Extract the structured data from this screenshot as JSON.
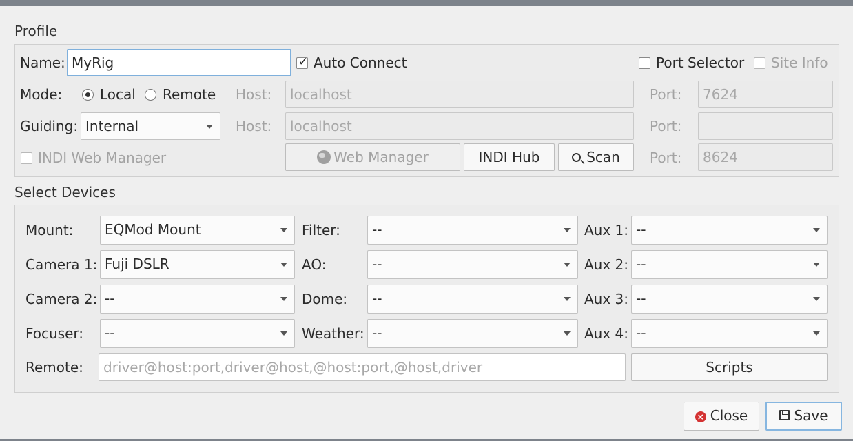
{
  "profile": {
    "section_title": "Profile",
    "name_label": "Name:",
    "name_value": "MyRig",
    "auto_connect_label": "Auto Connect",
    "auto_connect_checked": true,
    "port_selector_label": "Port Selector",
    "site_info_label": "Site Info",
    "mode_label": "Mode:",
    "mode_local": "Local",
    "mode_remote": "Remote",
    "mode_selected": "Local",
    "host_label": "Host:",
    "host_value": "localhost",
    "port_label": "Port:",
    "port_value": "7624",
    "guiding_label": "Guiding:",
    "guiding_value": "Internal",
    "guiding_host_label": "Host:",
    "guiding_host_value": "localhost",
    "guiding_port_label": "Port:",
    "guiding_port_value": "",
    "indi_web_manager_label": "INDI Web Manager",
    "web_manager_button": "Web Manager",
    "indi_hub_button": "INDI Hub",
    "scan_button": "Scan",
    "wm_port_label": "Port:",
    "wm_port_value": "8624"
  },
  "devices": {
    "section_title": "Select Devices",
    "mount_label": "Mount:",
    "mount_value": "EQMod Mount",
    "camera1_label": "Camera 1:",
    "camera1_value": "Fuji DSLR",
    "camera2_label": "Camera 2:",
    "camera2_value": "--",
    "focuser_label": "Focuser:",
    "focuser_value": "--",
    "filter_label": "Filter:",
    "filter_value": "--",
    "ao_label": "AO:",
    "ao_value": "--",
    "dome_label": "Dome:",
    "dome_value": "--",
    "weather_label": "Weather:",
    "weather_value": "--",
    "aux1_label": "Aux 1:",
    "aux1_value": "--",
    "aux2_label": "Aux 2:",
    "aux2_value": "--",
    "aux3_label": "Aux 3:",
    "aux3_value": "--",
    "aux4_label": "Aux 4:",
    "aux4_value": "--",
    "remote_label": "Remote:",
    "remote_placeholder": "driver@host:port,driver@host,@host:port,@host,driver",
    "scripts_button": "Scripts"
  },
  "footer": {
    "close_button": "Close",
    "save_button": "Save"
  },
  "colors": {
    "focus_border": "#7fb0dc",
    "close_icon": "#d43333",
    "title_bar": "#7d838b"
  },
  "icons": [
    "globe-icon",
    "search-icon",
    "close-icon",
    "save-icon",
    "chevron-down-icon",
    "check-icon"
  ]
}
